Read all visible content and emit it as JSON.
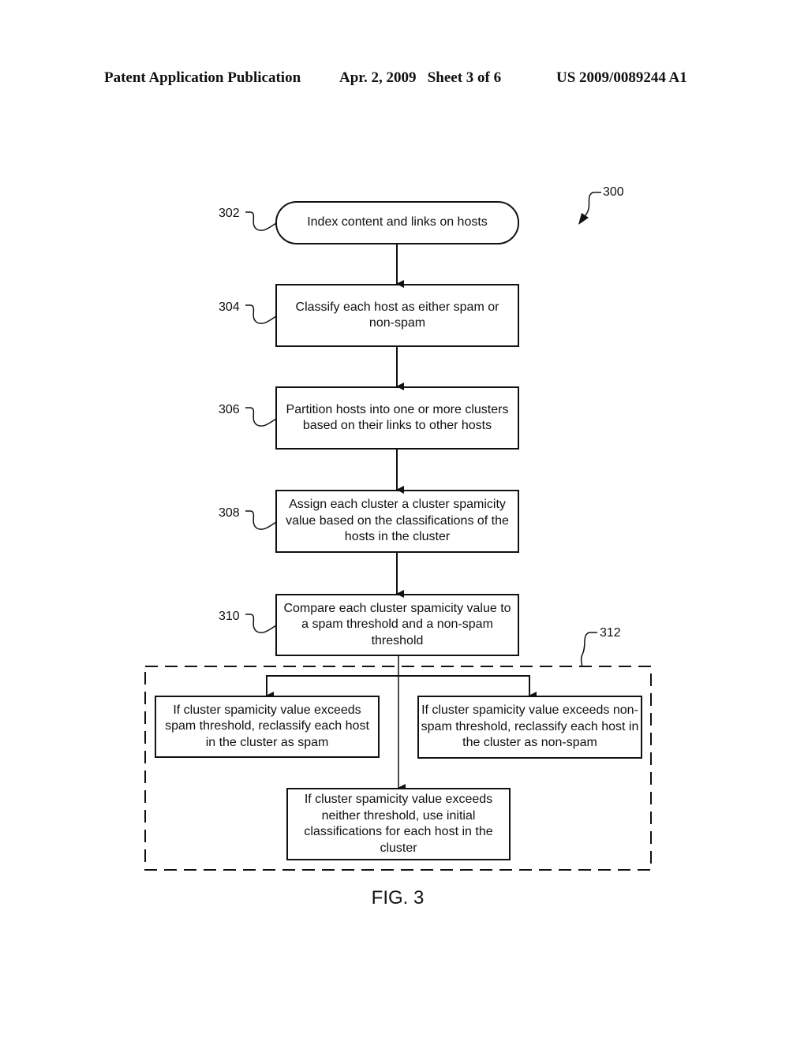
{
  "header": {
    "left": "Patent Application Publication",
    "middle": "Apr. 2, 2009   Sheet 3 of 6",
    "right": "US 2009/0089244 A1"
  },
  "figure": {
    "ref": "300",
    "caption": "FIG. 3"
  },
  "steps": [
    {
      "ref": "302",
      "shape": "terminal",
      "text": "Index content and links on hosts"
    },
    {
      "ref": "304",
      "shape": "process",
      "text": "Classify each host as either spam or non-spam"
    },
    {
      "ref": "306",
      "shape": "process",
      "text": "Partition hosts into one or more clusters based on their links to other hosts"
    },
    {
      "ref": "308",
      "shape": "process",
      "text": "Assign each cluster a cluster spamicity value based on the classifications of the hosts in the cluster"
    },
    {
      "ref": "310",
      "shape": "process",
      "text": "Compare each cluster spamicity value to a spam threshold and a non-spam threshold"
    }
  ],
  "group": {
    "ref": "312",
    "outcomes": [
      {
        "text": "If cluster spamicity value exceeds spam threshold, reclassify each host in the cluster as spam"
      },
      {
        "text": "If cluster spamicity value exceeds non-spam threshold, reclassify each host in the cluster as non-spam"
      },
      {
        "text": "If cluster spamicity value exceeds neither threshold, use initial classifications for each host in the cluster"
      }
    ]
  }
}
